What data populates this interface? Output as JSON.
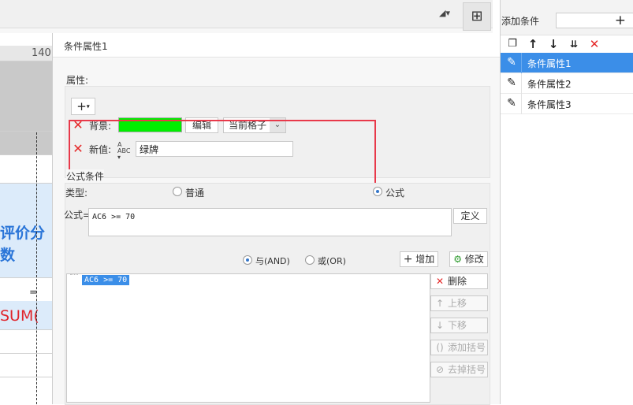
{
  "top_toolbar": {
    "filter_icon": "filter-sort-icon",
    "layout_icon": "layout-grid-icon"
  },
  "sheet": {
    "ruler_label": "140",
    "cell_header": "评价分\n数",
    "cell_header_line1": "评价分",
    "cell_header_line2": "数",
    "cell_formula": "SUM(",
    "cell_eq": "="
  },
  "dialog": {
    "title": "条件属性1",
    "attributes_label": "属性:",
    "add_symbol": "+",
    "background_label": "背景:",
    "background_color": "#00ee00",
    "edit_button": "编辑",
    "scope_select": "当前格子",
    "new_value_label": "新值:",
    "new_value": "绿牌",
    "formula_section_label": "公式条件",
    "type_label": "类型:",
    "type_options": [
      "普通",
      "公式"
    ],
    "type_selected": "公式",
    "formula_label": "公式=",
    "formula_value": "AC6 >= 70",
    "define_button": "定义",
    "and_label": "与(AND)",
    "or_label": "或(OR)",
    "logic_selected": "与(AND)",
    "add_button": "增加",
    "modify_button": "修改",
    "conditions": [
      "AC6 >= 70"
    ],
    "side_buttons": {
      "delete": "删除",
      "move_up": "上移",
      "move_down": "下移",
      "add_bracket": "添加括号",
      "remove_bracket": "去掉括号"
    },
    "accent_color": "#e52929",
    "highlight_color": "#e8394a"
  },
  "right_panel": {
    "title": "添加条件",
    "add_symbol": "+",
    "toolbar_icons": [
      "copy-icon",
      "arrow-up-icon",
      "arrow-down-icon",
      "move-bottom-icon",
      "delete-icon"
    ],
    "items": [
      {
        "label": "条件属性1",
        "selected": true
      },
      {
        "label": "条件属性2",
        "selected": false
      },
      {
        "label": "条件属性3",
        "selected": false
      }
    ],
    "selected_color": "#3b8ee8"
  }
}
